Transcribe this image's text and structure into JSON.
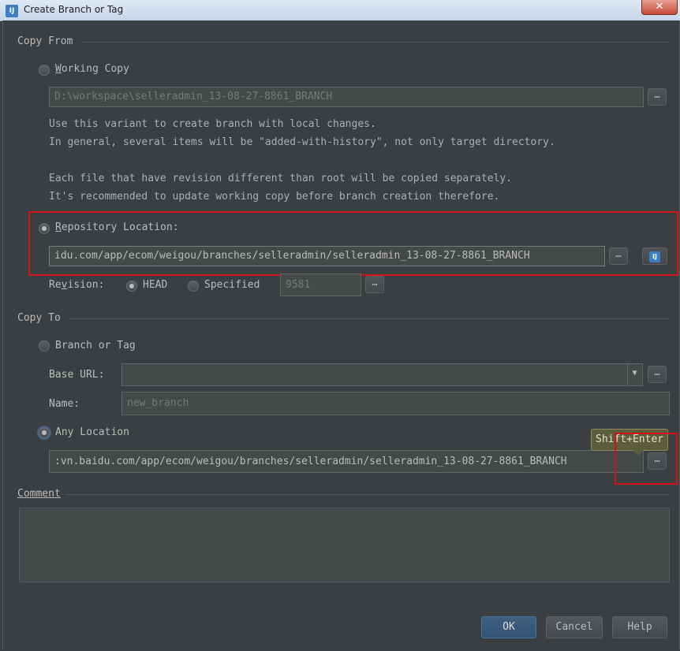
{
  "window": {
    "title": "Create Branch or Tag",
    "close_label": "✕"
  },
  "copy_from": {
    "section_title": "Copy From",
    "working_copy": {
      "label_underlined": "W",
      "label_rest": "orking Copy",
      "selected": false,
      "path_value": "D:\\workspace\\selleradmin_13-08-27-8861_BRANCH",
      "browse_label": "…",
      "description_lines": [
        "Use this variant to create branch with local changes.",
        "In general, several items will be \"added-with-history\", not only target directory.",
        "",
        "Each file that have revision different than root will be copied separately.",
        "It's recommended to update working copy before branch creation therefore."
      ]
    },
    "repository_location": {
      "label_underlined": "R",
      "label_rest": "epository Location:",
      "selected": true,
      "url_value": "idu.com/app/ecom/weigou/branches/selleradmin/selleradmin_13-08-27-8861_BRANCH",
      "browse_label": "…"
    },
    "revision": {
      "label_before": "Re",
      "label_underlined": "v",
      "label_after": "ision:",
      "head_label": "HEAD",
      "head_selected": true,
      "specified_label": "Specified",
      "specified_selected": false,
      "specified_value": "9581",
      "browse_label": "…"
    }
  },
  "copy_to": {
    "section_title": "Copy To",
    "branch_or_tag": {
      "label": "Branch or Tag",
      "selected": false,
      "base_url_label": "Base URL:",
      "base_url_value": "",
      "base_url_browse": "…",
      "name_label": "Name:",
      "name_value": "new_branch"
    },
    "any_location": {
      "label": "Any Location",
      "selected": true,
      "url_value": ":vn.baidu.com/app/ecom/weigou/branches/selleradmin/selleradmin_13-08-27-8861_BRANCH",
      "browse_label": "…",
      "tooltip": "Shift+Enter"
    }
  },
  "comment": {
    "label": "Comment",
    "value": ""
  },
  "buttons": {
    "ok": "OK",
    "cancel": "Cancel",
    "help": "Help"
  },
  "colors": {
    "background": "#3c3f41",
    "text": "#bbbbbb",
    "field_bg": "#45494a",
    "highlight_box": "#d0131a",
    "default_button": "#365880"
  },
  "icons": {
    "app": "intellij-icon",
    "vcs_browse": "intellij-icon"
  }
}
